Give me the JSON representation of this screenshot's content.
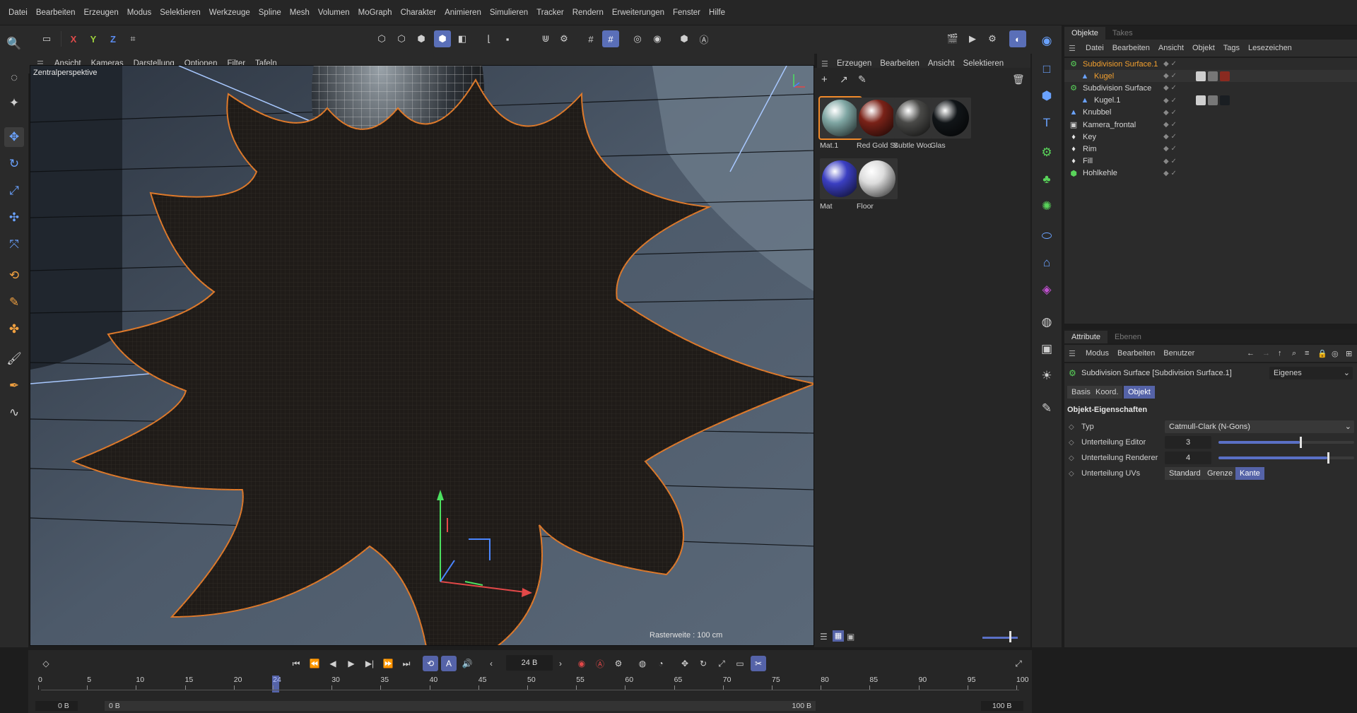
{
  "menubar": [
    "Datei",
    "Bearbeiten",
    "Erzeugen",
    "Modus",
    "Selektieren",
    "Werkzeuge",
    "Spline",
    "Mesh",
    "Volumen",
    "MoGraph",
    "Charakter",
    "Animieren",
    "Simulieren",
    "Tracker",
    "Rendern",
    "Erweiterungen",
    "Fenster",
    "Hilfe"
  ],
  "axis": {
    "x": "X",
    "y": "Y",
    "z": "Z"
  },
  "viewport": {
    "menu": [
      "Ansicht",
      "Kameras",
      "Darstellung",
      "Optionen",
      "Filter",
      "Tafeln"
    ],
    "label": "Zentralperspektive",
    "grid": "Rasterweite : 100 cm"
  },
  "materials": {
    "menu": [
      "Erzeugen",
      "Bearbeiten",
      "Ansicht",
      "Selektieren"
    ],
    "items": [
      {
        "name": "Mat.1",
        "color": "#7fa6a3"
      },
      {
        "name": "Red Gold Sc",
        "color": "#7a2218"
      },
      {
        "name": "Subtle Woo",
        "color": "#4a4a48"
      },
      {
        "name": "Glas",
        "color": "#111518"
      },
      {
        "name": "Mat",
        "color": "#3b3fc2"
      },
      {
        "name": "Floor",
        "color": "#dcdcdc"
      }
    ]
  },
  "objects": {
    "tabs": [
      "Objekte",
      "Takes"
    ],
    "menu": [
      "Datei",
      "Bearbeiten",
      "Ansicht",
      "Objekt",
      "Tags",
      "Lesezeichen"
    ],
    "rows": [
      {
        "name": "Subdivision Surface.1",
        "icon": "subdivision-icon",
        "indent": 0,
        "highlight": true
      },
      {
        "name": "Kugel",
        "icon": "sphere-icon",
        "indent": 1,
        "highlight": true
      },
      {
        "name": "Subdivision Surface",
        "icon": "subdivision-icon",
        "indent": 0,
        "highlight": false
      },
      {
        "name": "Kugel.1",
        "icon": "sphere-icon",
        "indent": 1,
        "highlight": false
      },
      {
        "name": "Knubbel",
        "icon": "displacer-icon",
        "indent": 0,
        "highlight": false
      },
      {
        "name": "Kamera_frontal",
        "icon": "camera-icon",
        "indent": 0,
        "highlight": false
      },
      {
        "name": "Key",
        "icon": "light-icon",
        "indent": 0,
        "highlight": false
      },
      {
        "name": "Rim",
        "icon": "light-icon",
        "indent": 0,
        "highlight": false
      },
      {
        "name": "Fill",
        "icon": "light-icon",
        "indent": 0,
        "highlight": false
      },
      {
        "name": "Hohlkehle",
        "icon": "background-icon",
        "indent": 0,
        "highlight": false
      }
    ]
  },
  "attributes": {
    "tabs": [
      "Attribute",
      "Ebenen"
    ],
    "menu": [
      "Modus",
      "Bearbeiten",
      "Benutzer"
    ],
    "title": "Subdivision Surface [Subdivision Surface.1]",
    "mode": "Eigenes",
    "subtabs": [
      "Basis",
      "Koord.",
      "Objekt"
    ],
    "section": "Objekt-Eigenschaften",
    "typ_label": "Typ",
    "typ_value": "Catmull-Clark (N-Gons)",
    "editor_label": "Unterteilung Editor",
    "editor_value": "3",
    "editor_fraction": 0.6,
    "renderer_label": "Unterteilung Renderer",
    "renderer_value": "4",
    "renderer_fraction": 0.8,
    "uv_label": "Unterteilung UVs",
    "uv_options": [
      "Standard",
      "Grenze",
      "Kante"
    ],
    "uv_selected": "Kante"
  },
  "timeline": {
    "frame": "24 B",
    "current": 24,
    "ticks": [
      "0",
      "5",
      "10",
      "15",
      "20",
      "24",
      "30",
      "35",
      "40",
      "45",
      "50",
      "55",
      "60",
      "65",
      "70",
      "75",
      "80",
      "85",
      "90",
      "95",
      "100"
    ],
    "start": "0 B",
    "start2": "0 B",
    "end": "100 B",
    "end2": "100 B"
  }
}
